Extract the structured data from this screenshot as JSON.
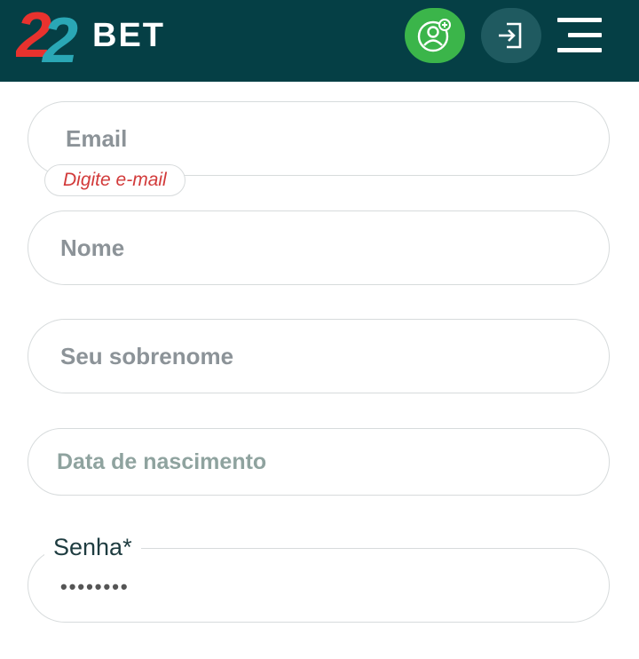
{
  "header": {
    "logo": {
      "text_left": "22",
      "text_right": "BET"
    },
    "icons": {
      "register": "user-add-icon",
      "login": "login-icon",
      "menu": "hamburger-menu-icon"
    },
    "colors": {
      "background": "#053f45",
      "register_button": "#3bb54a",
      "login_button": "#1f5a60"
    }
  },
  "form": {
    "email": {
      "placeholder": "Email",
      "error": "Digite e-mail"
    },
    "name": {
      "placeholder": "Nome"
    },
    "surname": {
      "placeholder": "Seu sobrenome"
    },
    "birthdate": {
      "placeholder": "Data de nascimento"
    },
    "password": {
      "label": "Senha",
      "required_mark": "*",
      "value": "••••••••"
    }
  }
}
